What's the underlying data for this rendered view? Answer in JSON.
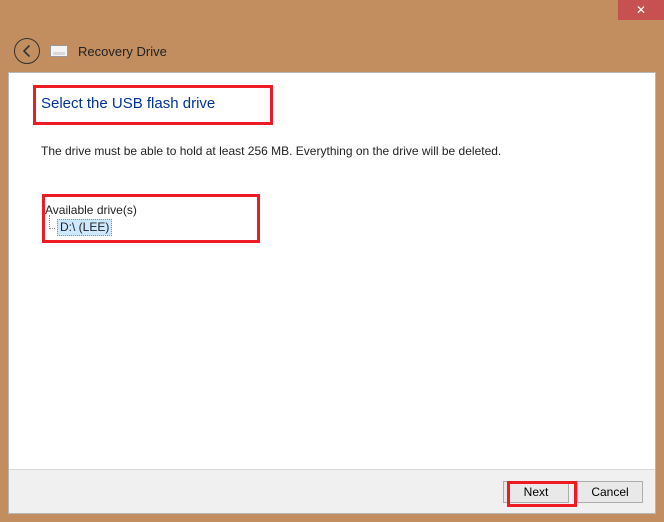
{
  "window": {
    "close_glyph": "✕",
    "back_glyph": "←",
    "title": "Recovery Drive"
  },
  "page": {
    "heading": "Select the USB flash drive",
    "description": "The drive must be able to hold at least 256 MB. Everything on the drive will be deleted."
  },
  "drives": {
    "label": "Available drive(s)",
    "items": [
      "D:\\ (LEE)"
    ]
  },
  "buttons": {
    "next": "Next",
    "cancel": "Cancel"
  }
}
